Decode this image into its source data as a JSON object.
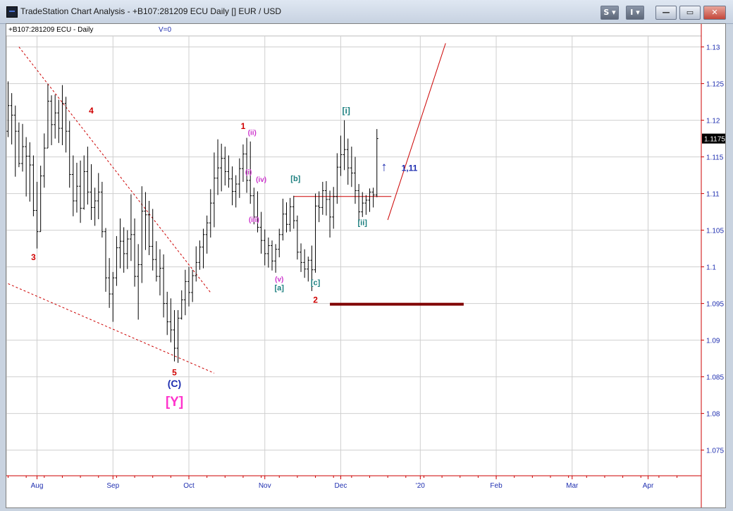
{
  "window": {
    "title": "TradeStation Chart Analysis - +B107:281209 ECU Daily [] EUR / USD",
    "buttons": [
      "S",
      "I"
    ]
  },
  "chart_header": {
    "symbol": "+B107:281209 ECU - Daily",
    "volume": "V=0"
  },
  "chart_data": {
    "type": "ohlc",
    "y_ticks": [
      "1.13",
      "1.125",
      "1.12",
      "1.115",
      "1.11",
      "1.105",
      "1.1",
      "1.095",
      "1.09",
      "1.085",
      "1.08",
      "1.075"
    ],
    "x_ticks": [
      "Aug",
      "Sep",
      "Oct",
      "Nov",
      "Dec",
      "'20",
      "Feb",
      "Mar",
      "Apr"
    ],
    "ylim": [
      1.0715,
      1.1315
    ],
    "last_price": "1.1175",
    "grid": true,
    "bars": [
      [
        0,
        1.1185,
        1.1253,
        1.1177,
        1.122
      ],
      [
        1,
        1.122,
        1.1237,
        1.1167,
        1.1207
      ],
      [
        2,
        1.1207,
        1.122,
        1.1123,
        1.1185
      ],
      [
        3,
        1.1185,
        1.1197,
        1.1136,
        1.1141
      ],
      [
        4,
        1.1141,
        1.1195,
        1.113,
        1.1164
      ],
      [
        5,
        1.1164,
        1.1177,
        1.1096,
        1.1151
      ],
      [
        6,
        1.1151,
        1.117,
        1.1089,
        1.1139
      ],
      [
        7,
        1.1139,
        1.1152,
        1.1069,
        1.1077
      ],
      [
        8,
        1.1077,
        1.1116,
        1.1025,
        1.1048
      ],
      [
        9,
        1.1048,
        1.1138,
        1.1048,
        1.1124
      ],
      [
        10,
        1.1124,
        1.1182,
        1.1108,
        1.1162
      ],
      [
        11,
        1.1162,
        1.1249,
        1.1162,
        1.1226
      ],
      [
        12,
        1.1226,
        1.1234,
        1.1166,
        1.1194
      ],
      [
        13,
        1.1194,
        1.1235,
        1.1175,
        1.121
      ],
      [
        14,
        1.121,
        1.1228,
        1.1169,
        1.1189
      ],
      [
        15,
        1.1189,
        1.1248,
        1.1166,
        1.1223
      ],
      [
        16,
        1.1223,
        1.1232,
        1.1156,
        1.1185
      ],
      [
        17,
        1.1185,
        1.1199,
        1.1108,
        1.1126
      ],
      [
        18,
        1.1126,
        1.1152,
        1.1069,
        1.109
      ],
      [
        19,
        1.109,
        1.1142,
        1.1074,
        1.111
      ],
      [
        20,
        1.111,
        1.1145,
        1.106,
        1.108
      ],
      [
        21,
        1.108,
        1.1152,
        1.1078,
        1.113
      ],
      [
        22,
        1.113,
        1.1164,
        1.1085,
        1.1102
      ],
      [
        23,
        1.1102,
        1.114,
        1.1064,
        1.1081
      ],
      [
        24,
        1.1081,
        1.1108,
        1.1056,
        1.109
      ],
      [
        25,
        1.109,
        1.1128,
        1.1065,
        1.1102
      ],
      [
        26,
        1.1102,
        1.1116,
        1.104,
        1.1048
      ],
      [
        27,
        1.1048,
        1.1053,
        1.0966,
        1.0985
      ],
      [
        28,
        1.0985,
        1.1012,
        1.0944,
        1.0963
      ],
      [
        29,
        1.0963,
        1.0993,
        1.0925,
        1.0985
      ],
      [
        30,
        1.0985,
        1.1042,
        1.0974,
        1.1026
      ],
      [
        31,
        1.1026,
        1.1066,
        1.0998,
        1.1035
      ],
      [
        32,
        1.1035,
        1.1054,
        1.0992,
        1.1018
      ],
      [
        33,
        1.1018,
        1.105,
        1.0997,
        1.1038
      ],
      [
        34,
        1.1038,
        1.1099,
        1.1008,
        1.1044
      ],
      [
        35,
        1.1044,
        1.1066,
        1.0973,
        1.0987
      ],
      [
        36,
        1.0987,
        1.1031,
        1.0928,
        1.1003
      ],
      [
        37,
        1.1003,
        1.111,
        1.0978,
        1.1076
      ],
      [
        38,
        1.1076,
        1.1102,
        1.1023,
        1.1071
      ],
      [
        39,
        1.1071,
        1.109,
        1.1016,
        1.1028
      ],
      [
        40,
        1.1028,
        1.1079,
        1.0995,
        1.101
      ],
      [
        41,
        1.101,
        1.1035,
        1.098,
        1.0987
      ],
      [
        42,
        1.0987,
        1.1024,
        1.0961,
        1.0998
      ],
      [
        43,
        1.0998,
        1.1017,
        1.0931,
        1.095
      ],
      [
        44,
        1.095,
        1.0966,
        1.0907,
        1.0925
      ],
      [
        45,
        1.0925,
        1.0957,
        1.0897,
        1.0914
      ],
      [
        46,
        1.0914,
        1.0941,
        1.0871,
        1.0889
      ],
      [
        47,
        1.0889,
        1.0941,
        1.0869,
        1.093
      ],
      [
        48,
        1.093,
        1.0968,
        1.0928,
        1.0955
      ],
      [
        49,
        1.0955,
        1.0996,
        1.0934,
        1.098
      ],
      [
        50,
        1.098,
        1.1,
        1.0946,
        1.0965
      ],
      [
        51,
        1.0965,
        1.0996,
        1.0952,
        1.0988
      ],
      [
        52,
        1.0988,
        1.1028,
        1.098,
        1.1006
      ],
      [
        53,
        1.1006,
        1.1036,
        1.0996,
        1.1027
      ],
      [
        54,
        1.1027,
        1.1052,
        1.0998,
        1.1044
      ],
      [
        55,
        1.1044,
        1.107,
        1.1018,
        1.106
      ],
      [
        56,
        1.106,
        1.1106,
        1.104,
        1.1087
      ],
      [
        57,
        1.1087,
        1.1156,
        1.1054,
        1.1121
      ],
      [
        58,
        1.1121,
        1.1174,
        1.1098,
        1.1135
      ],
      [
        59,
        1.1135,
        1.1168,
        1.1103,
        1.1148
      ],
      [
        60,
        1.1148,
        1.1164,
        1.1111,
        1.113
      ],
      [
        61,
        1.113,
        1.1152,
        1.1108,
        1.112
      ],
      [
        62,
        1.112,
        1.1137,
        1.1084,
        1.1103
      ],
      [
        63,
        1.1103,
        1.1125,
        1.1081,
        1.1113
      ],
      [
        64,
        1.1113,
        1.1148,
        1.1094,
        1.1134
      ],
      [
        65,
        1.1134,
        1.1167,
        1.1116,
        1.1154
      ],
      [
        66,
        1.1154,
        1.1176,
        1.1101,
        1.1118
      ],
      [
        67,
        1.1118,
        1.1171,
        1.1086,
        1.1097
      ],
      [
        68,
        1.1097,
        1.1108,
        1.1058,
        1.1068
      ],
      [
        69,
        1.1068,
        1.1103,
        1.1047,
        1.1054
      ],
      [
        70,
        1.1054,
        1.1075,
        1.1018,
        1.1036
      ],
      [
        71,
        1.1036,
        1.1051,
        1.1002,
        1.1018
      ],
      [
        72,
        1.1018,
        1.104,
        1.0999,
        1.1029
      ],
      [
        73,
        1.1029,
        1.1036,
        1.0995,
        1.1008
      ],
      [
        74,
        1.1008,
        1.1031,
        1.0992,
        1.1024
      ],
      [
        75,
        1.1024,
        1.1052,
        1.1013,
        1.1044
      ],
      [
        76,
        1.1044,
        1.1093,
        1.1036,
        1.1072
      ],
      [
        77,
        1.1072,
        1.1088,
        1.1047,
        1.1058
      ],
      [
        78,
        1.1058,
        1.1094,
        1.1048,
        1.1082
      ],
      [
        79,
        1.1082,
        1.1097,
        1.1052,
        1.1063
      ],
      [
        80,
        1.1063,
        1.107,
        1.101,
        1.102
      ],
      [
        81,
        1.102,
        1.1032,
        1.0993,
        1.1006
      ],
      [
        82,
        1.1006,
        1.1024,
        1.0985,
        1.0997
      ],
      [
        83,
        1.0997,
        1.1014,
        1.098,
        1.1009
      ],
      [
        84,
        1.1009,
        1.1029,
        1.0967,
        1.0996
      ],
      [
        85,
        1.0996,
        1.11,
        1.0992,
        1.1083
      ],
      [
        86,
        1.1083,
        1.1103,
        1.1061,
        1.1081
      ],
      [
        87,
        1.1081,
        1.1116,
        1.1071,
        1.1104
      ],
      [
        88,
        1.1104,
        1.1117,
        1.107,
        1.1092
      ],
      [
        89,
        1.1092,
        1.1104,
        1.104,
        1.1068
      ],
      [
        90,
        1.1068,
        1.1109,
        1.1052,
        1.1096
      ],
      [
        91,
        1.1096,
        1.1155,
        1.1086,
        1.1136
      ],
      [
        92,
        1.1136,
        1.1179,
        1.1124,
        1.1153
      ],
      [
        93,
        1.1153,
        1.12,
        1.1132,
        1.116
      ],
      [
        94,
        1.116,
        1.1175,
        1.1112,
        1.1135
      ],
      [
        95,
        1.1135,
        1.1164,
        1.1109,
        1.1128
      ],
      [
        96,
        1.1128,
        1.115,
        1.1086,
        1.1104
      ],
      [
        97,
        1.1104,
        1.1113,
        1.1061,
        1.1075
      ],
      [
        98,
        1.1075,
        1.1102,
        1.1068,
        1.1087
      ],
      [
        99,
        1.1087,
        1.1098,
        1.1071,
        1.1091
      ],
      [
        100,
        1.1091,
        1.1107,
        1.1075,
        1.1102
      ],
      [
        101,
        1.1102,
        1.1108,
        1.1081,
        1.1098
      ],
      [
        102,
        1.1098,
        1.1188,
        1.1095,
        1.1175
      ]
    ],
    "lines": [
      {
        "color": "#cc0000",
        "style": "dashed",
        "points": [
          [
            3,
            1.13
          ],
          [
            56,
            1.0965
          ]
        ]
      },
      {
        "color": "#cc0000",
        "style": "dashed",
        "points": [
          [
            0,
            1.0977
          ],
          [
            57,
            1.0855
          ]
        ]
      },
      {
        "color": "#cc0000",
        "style": "solid",
        "points": [
          [
            79,
            1.1096
          ],
          [
            106,
            1.1096
          ]
        ]
      },
      {
        "color": "#cc0000",
        "style": "solid",
        "points": [
          [
            105,
            1.1064
          ],
          [
            121,
            1.1305
          ]
        ]
      },
      {
        "color": "#800000",
        "style": "thick",
        "points": [
          [
            89,
            1.0949
          ],
          [
            126,
            1.0949
          ]
        ]
      }
    ],
    "annotations": [
      {
        "text": "4",
        "x": 23,
        "y": 1.1209,
        "color": "#d00000",
        "size": 12
      },
      {
        "text": "3",
        "x": 7,
        "y": 1.1009,
        "color": "#d00000",
        "size": 12
      },
      {
        "text": "5",
        "x": 46,
        "y": 1.0852,
        "color": "#d00000",
        "size": 12
      },
      {
        "text": "(C)",
        "x": 46,
        "y": 1.0836,
        "color": "#1f2fb0",
        "size": 14
      },
      {
        "text": "[Y]",
        "x": 46,
        "y": 1.081,
        "color": "#ff33cc",
        "size": 19
      },
      {
        "text": "1",
        "x": 65,
        "y": 1.1188,
        "color": "#d00000",
        "size": 12
      },
      {
        "text": "(ii)",
        "x": 67.5,
        "y": 1.118,
        "color": "#cc33cc",
        "size": 10
      },
      {
        "text": "(i)",
        "x": 66.5,
        "y": 1.1126,
        "color": "#cc33cc",
        "size": 10
      },
      {
        "text": "(iv)",
        "x": 70,
        "y": 1.1116,
        "color": "#cc33cc",
        "size": 10
      },
      {
        "text": "(iii)",
        "x": 68,
        "y": 1.1061,
        "color": "#cc33cc",
        "size": 10
      },
      {
        "text": "(v)",
        "x": 75,
        "y": 1.098,
        "color": "#cc33cc",
        "size": 10
      },
      {
        "text": "[a]",
        "x": 75,
        "y": 1.0968,
        "color": "#1b7f7f",
        "size": 11
      },
      {
        "text": "[b]",
        "x": 79.5,
        "y": 1.1117,
        "color": "#1b7f7f",
        "size": 11
      },
      {
        "text": "[c]",
        "x": 85,
        "y": 1.0975,
        "color": "#1b7f7f",
        "size": 11
      },
      {
        "text": "2",
        "x": 85,
        "y": 1.0951,
        "color": "#d00000",
        "size": 12
      },
      {
        "text": "[i]",
        "x": 93.5,
        "y": 1.1209,
        "color": "#1b7f7f",
        "size": 12
      },
      {
        "text": "[ii]",
        "x": 98,
        "y": 1.1057,
        "color": "#1b7f7f",
        "size": 11
      },
      {
        "text": "1,11",
        "x": 111,
        "y": 1.1131,
        "color": "#1f2fb0",
        "size": 12
      },
      {
        "text": "↑",
        "x": 104,
        "y": 1.1131,
        "color": "#1f2fb0",
        "size": 18
      }
    ]
  }
}
